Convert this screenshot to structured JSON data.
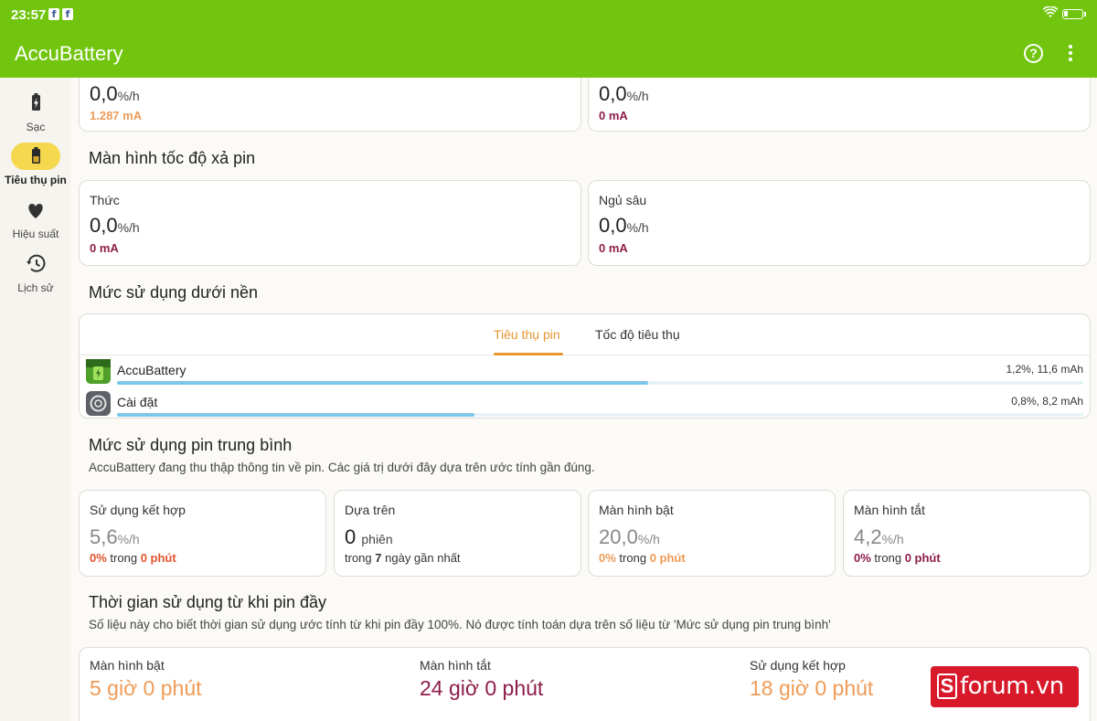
{
  "status_bar": {
    "time": "23:57",
    "notif_icons": [
      "facebook-icon",
      "facebook-icon"
    ]
  },
  "app_bar": {
    "title": "AccuBattery"
  },
  "sidebar": {
    "items": [
      {
        "label": "Sạc",
        "icon": "battery-charging-icon",
        "active": false
      },
      {
        "label": "Tiêu thụ pin",
        "icon": "battery-low-icon",
        "active": true
      },
      {
        "label": "Hiệu suất",
        "icon": "heart-icon",
        "active": false
      },
      {
        "label": "Lịch sử",
        "icon": "history-icon",
        "active": false
      }
    ]
  },
  "top_cards": [
    {
      "value": "0,0",
      "unit": "%/h",
      "sub": "1.287 mA",
      "sub_color": "orange"
    },
    {
      "value": "0,0",
      "unit": "%/h",
      "sub": "0 mA",
      "sub_color": "maroon"
    }
  ],
  "screen_drain": {
    "title": "Màn hình tốc độ xả pin",
    "cards": [
      {
        "label": "Thức",
        "value": "0,0",
        "unit": "%/h",
        "sub": "0 mA"
      },
      {
        "label": "Ngủ sâu",
        "value": "0,0",
        "unit": "%/h",
        "sub": "0 mA"
      }
    ]
  },
  "background_usage": {
    "title": "Mức sử dụng dưới nền",
    "tabs": [
      {
        "label": "Tiêu thụ pin",
        "active": true
      },
      {
        "label": "Tốc độ tiêu thụ",
        "active": false
      }
    ],
    "apps": [
      {
        "name": "AccuBattery",
        "value": "1,2%, 11,6 mAh",
        "fraction": 0.55,
        "icon": "accubattery-app-icon"
      },
      {
        "name": "Cài đặt",
        "value": "0,8%, 8,2 mAh",
        "fraction": 0.37,
        "icon": "settings-app-icon"
      }
    ]
  },
  "average_usage": {
    "title": "Mức sử dụng pin trung bình",
    "desc": "AccuBattery đang thu thập thông tin về pin. Các giá trị dưới đây dựa trên ước tính gần đúng.",
    "cards": [
      {
        "label": "Sử dụng kết hợp",
        "value": "5,6",
        "unit": "%/h",
        "pct": "0%",
        "mid": "trong",
        "dur": "0 phút"
      },
      {
        "label": "Dựa trên",
        "value": "0",
        "unit": "phiên",
        "pre": "trong",
        "bold": "7",
        "post": "ngày gần nhất"
      },
      {
        "label": "Màn hình bật",
        "value": "20,0",
        "unit": "%/h",
        "pct": "0%",
        "mid": "trong",
        "dur": "0 phút"
      },
      {
        "label": "Màn hình tắt",
        "value": "4,2",
        "unit": "%/h",
        "pct": "0%",
        "mid": "trong",
        "dur": "0 phút"
      }
    ]
  },
  "time_since_full": {
    "title": "Thời gian sử dụng từ khi pin đầy",
    "desc": "Số liệu này cho biết thời gian sử dụng ước tính từ khi pin đầy 100%. Nó được tính toán dựa trên số liệu từ 'Mức sử dụng pin trung bình'",
    "cols": [
      {
        "label": "Màn hình bật",
        "value": "5 giờ 0 phút"
      },
      {
        "label": "Màn hình tắt",
        "value": "24 giờ 0 phút"
      },
      {
        "label": "Sử dụng kết hợp",
        "value": "18 giờ 0 phút"
      }
    ]
  },
  "watermark": {
    "letter": "S",
    "text": "forum.vn"
  },
  "colors": {
    "accent": "#72c50f",
    "orange": "#ee9b57",
    "maroon": "#8d1d4a",
    "tab_active": "#e8962f",
    "bar": "#7dc6ea"
  }
}
